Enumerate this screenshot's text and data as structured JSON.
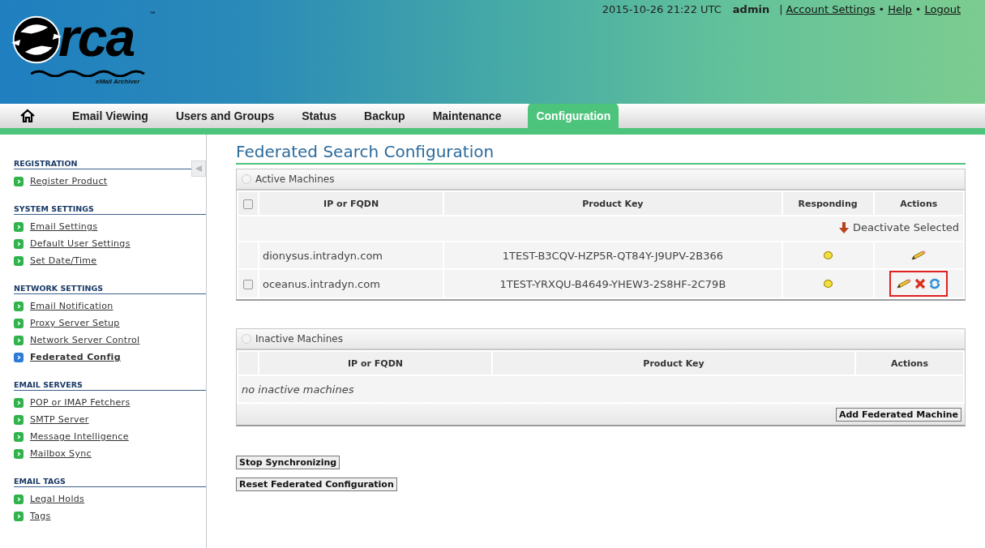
{
  "logo": {
    "wordmark": "rca",
    "trademark": "™",
    "tagline": "eMail Archiver"
  },
  "top_bar": {
    "datetime": "2015-10-26 21:22 UTC",
    "user": "admin",
    "separator": "|",
    "links": [
      "Account Settings",
      "Help",
      "Logout"
    ],
    "bullet": "•"
  },
  "tabs": [
    {
      "label": "Email Viewing",
      "selected": false
    },
    {
      "label": "Users and Groups",
      "selected": false
    },
    {
      "label": "Status",
      "selected": false
    },
    {
      "label": "Backup",
      "selected": false
    },
    {
      "label": "Maintenance",
      "selected": false
    },
    {
      "label": "Configuration",
      "selected": true
    }
  ],
  "sidebar": {
    "sections": [
      {
        "title": "REGISTRATION",
        "items": [
          {
            "label": "Register Product",
            "selected": false
          }
        ]
      },
      {
        "title": "SYSTEM SETTINGS",
        "items": [
          {
            "label": "Email Settings",
            "selected": false
          },
          {
            "label": "Default User Settings",
            "selected": false
          },
          {
            "label": "Set Date/Time",
            "selected": false
          }
        ]
      },
      {
        "title": "NETWORK SETTINGS",
        "items": [
          {
            "label": "Email Notification",
            "selected": false
          },
          {
            "label": "Proxy Server Setup",
            "selected": false
          },
          {
            "label": "Network Server Control",
            "selected": false
          },
          {
            "label": "Federated Config",
            "selected": true
          }
        ]
      },
      {
        "title": "EMAIL SERVERS",
        "items": [
          {
            "label": "POP or IMAP Fetchers",
            "selected": false
          },
          {
            "label": "SMTP Server",
            "selected": false
          },
          {
            "label": "Message Intelligence",
            "selected": false
          },
          {
            "label": "Mailbox Sync",
            "selected": false
          }
        ]
      },
      {
        "title": "EMAIL TAGS",
        "items": [
          {
            "label": "Legal Holds",
            "selected": false
          },
          {
            "label": "Tags",
            "selected": false
          }
        ]
      }
    ]
  },
  "page_title": "Federated Search Configuration",
  "active_machines": {
    "title": "Active Machines",
    "columns": [
      "IP or FQDN",
      "Product Key",
      "Responding",
      "Actions"
    ],
    "select_all_checked": false,
    "bulk_action": "Deactivate Selected",
    "rows": [
      {
        "host": "dionysus.intradyn.com",
        "product_key": "1TEST-B3CQV-HZP5R-QT84Y-J9UPV-2B366",
        "selectable": false,
        "responding": true,
        "actions": [
          {
            "kind": "edit"
          }
        ],
        "highlighted": false
      },
      {
        "host": "oceanus.intradyn.com",
        "product_key": "1TEST-YRXQU-B4649-YHEW3-2S8HF-2C79B",
        "selectable": true,
        "checked": false,
        "responding": true,
        "actions": [
          {
            "kind": "edit"
          },
          {
            "kind": "delete"
          },
          {
            "kind": "refresh"
          }
        ],
        "highlighted": true
      }
    ]
  },
  "inactive_machines": {
    "title": "Inactive Machines",
    "columns": [
      "IP or FQDN",
      "Product Key",
      "Actions"
    ],
    "empty_message": "no inactive machines",
    "button": "Add Federated Machine"
  },
  "buttons": [
    "Stop Synchronizing",
    "Reset Federated Configuration"
  ]
}
